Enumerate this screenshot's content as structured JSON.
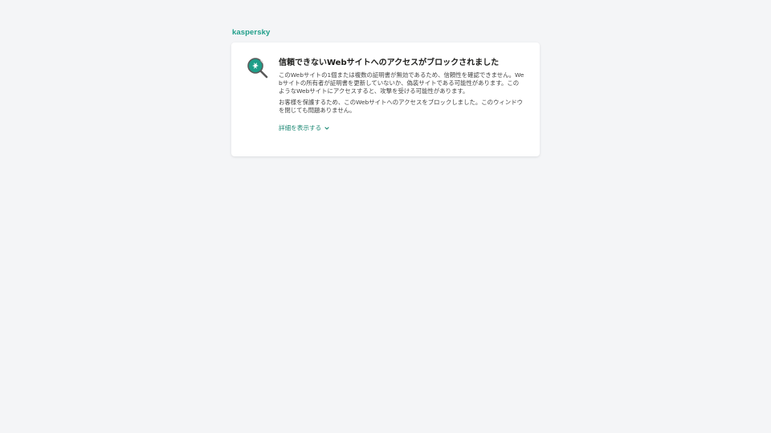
{
  "brand": {
    "logo_text": "kaspersky",
    "accent_color": "#1f9e89"
  },
  "warning": {
    "icon": "magnifier-certificate-icon",
    "title": "信頼できないWebサイトへのアクセスがブロックされました",
    "paragraph_1": "このWebサイトの1個または複数の証明書が無効であるため、信頼性を確認できません。Webサイトの所有者が証明書を更新していないか、偽装サイトである可能性があります。このようなWebサイトにアクセスすると、攻撃を受ける可能性があります。",
    "paragraph_2": "お客様を保護するため、このWebサイトへのアクセスをブロックしました。このウィンドウを閉じても問題ありません。",
    "details_link": "詳細を表示する",
    "details_icon": "chevron-down-icon"
  }
}
